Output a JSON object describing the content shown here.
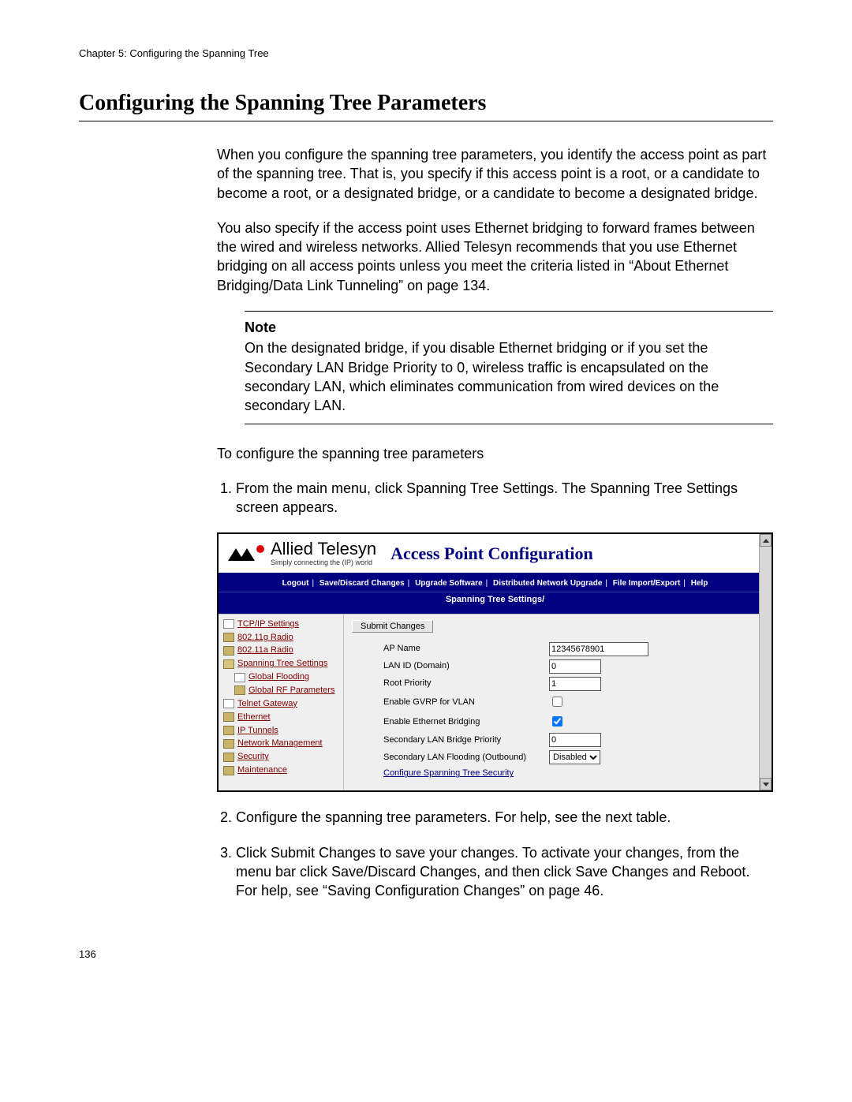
{
  "chapter_header": "Chapter 5: Configuring the Spanning Tree",
  "section_title": "Configuring the Spanning Tree Parameters",
  "para1": "When you configure the spanning tree parameters, you identify the access point as part of the spanning tree. That is, you specify if this access point is a root, or a candidate to become a root, or a designated bridge, or a candidate to become a designated bridge.",
  "para2": "You also specify if the access point uses Ethernet bridging to forward frames between the wired and wireless networks. Allied Telesyn recommends that you use Ethernet bridging on all access points unless you meet the criteria listed in “About Ethernet Bridging/Data Link Tunneling” on page 134.",
  "note": {
    "label": "Note",
    "text": "On the designated bridge, if you disable Ethernet bridging or if you set the Secondary LAN Bridge Priority to 0, wireless traffic is encapsulated on the secondary LAN, which eliminates communication from wired devices on the secondary LAN."
  },
  "para3": "To configure the spanning tree parameters",
  "steps": {
    "s1": "From the main menu, click Spanning Tree Settings. The Spanning Tree Settings screen appears.",
    "s2": "Configure the spanning tree parameters. For help, see the next table.",
    "s3": "Click Submit Changes to save your changes. To activate your changes, from the menu bar click Save/Discard Changes, and then click Save Changes and Reboot. For help, see “Saving Configuration Changes” on page 46."
  },
  "screenshot": {
    "brand_name": "Allied Telesyn",
    "brand_tag": "Simply connecting the (IP) world",
    "banner_title": "Access Point Configuration",
    "menu": {
      "logout": "Logout",
      "save": "Save/Discard Changes",
      "upgrade": "Upgrade Software",
      "dist": "Distributed Network Upgrade",
      "file": "File Import/Export",
      "help": "Help"
    },
    "subtitle": "Spanning Tree Settings/",
    "nav": {
      "0": "TCP/IP Settings",
      "1": "802.11g Radio",
      "2": "802.11a Radio",
      "3": "Spanning Tree Settings",
      "3a": "Global Flooding",
      "3b": "Global RF Parameters",
      "4": "Telnet Gateway",
      "5": "Ethernet",
      "6": "IP Tunnels",
      "7": "Network Management",
      "8": "Security",
      "9": "Maintenance"
    },
    "submit_label": "Submit Changes",
    "form": {
      "ap_name_label": "AP Name",
      "ap_name_value": "12345678901",
      "lan_id_label": "LAN ID (Domain)",
      "lan_id_value": "0",
      "root_prio_label": "Root Priority",
      "root_prio_value": "1",
      "gvrp_label": "Enable GVRP for VLAN",
      "eth_label": "Enable Ethernet Bridging",
      "sec_prio_label": "Secondary LAN Bridge Priority",
      "sec_prio_value": "0",
      "sec_flood_label": "Secondary LAN Flooding (Outbound)",
      "sec_flood_value": "Disabled",
      "cfg_link": "Configure Spanning Tree Security"
    }
  },
  "page_number": "136"
}
